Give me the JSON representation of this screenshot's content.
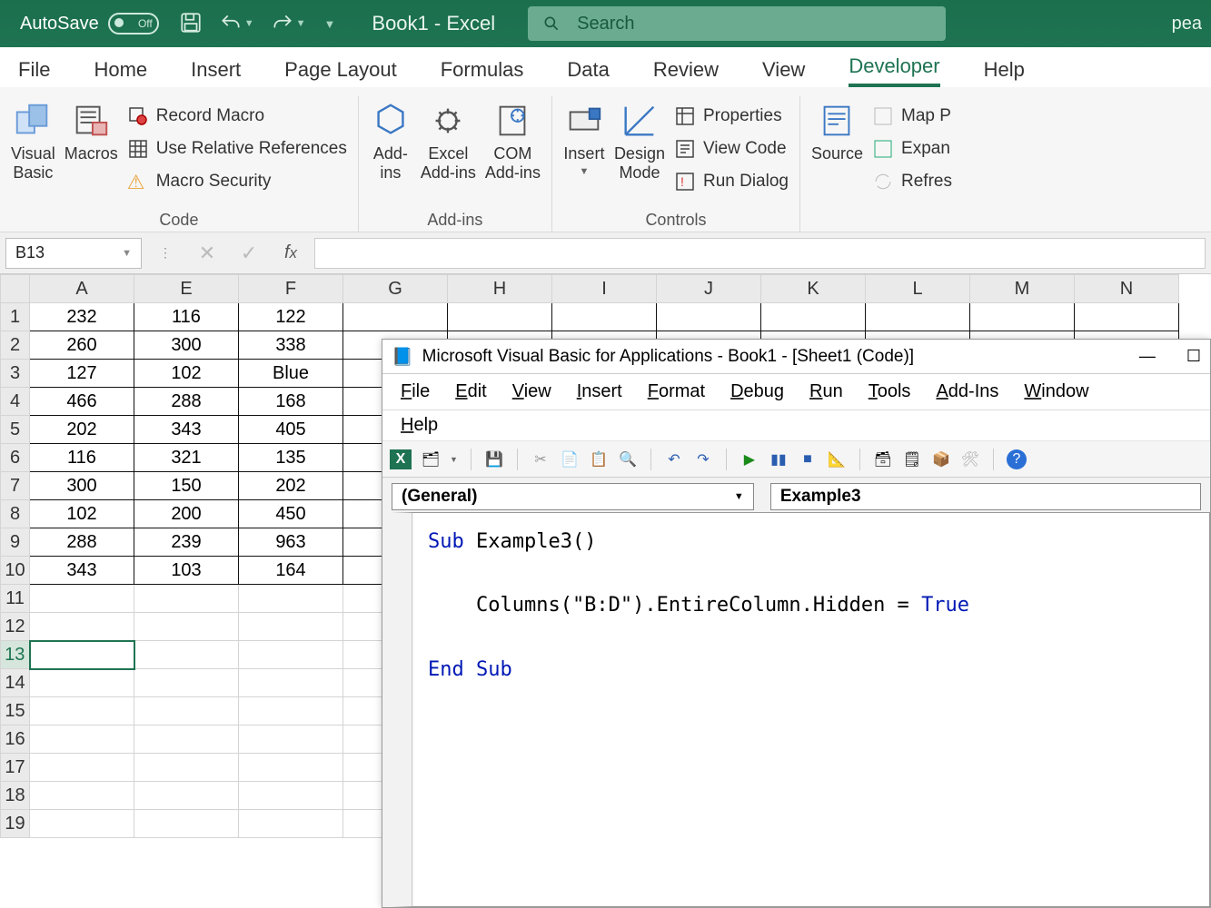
{
  "titlebar": {
    "autosave_label": "AutoSave",
    "autosave_state": "Off",
    "doc_title": "Book1 - Excel",
    "search_placeholder": "Search",
    "user": "pea"
  },
  "tabs": [
    "File",
    "Home",
    "Insert",
    "Page Layout",
    "Formulas",
    "Data",
    "Review",
    "View",
    "Developer",
    "Help"
  ],
  "active_tab": "Developer",
  "ribbon": {
    "code": {
      "visual_basic": "Visual\nBasic",
      "macros": "Macros",
      "record_macro": "Record Macro",
      "use_relative": "Use Relative References",
      "macro_security": "Macro Security",
      "group": "Code"
    },
    "addins": {
      "addins": "Add-\nins",
      "excel_addins": "Excel\nAdd-ins",
      "com_addins": "COM\nAdd-ins",
      "group": "Add-ins"
    },
    "controls": {
      "insert": "Insert",
      "design_mode": "Design\nMode",
      "properties": "Properties",
      "view_code": "View Code",
      "run_dialog": "Run Dialog",
      "group": "Controls"
    },
    "xml": {
      "source": "Source",
      "map": "Map P",
      "expand": "Expan",
      "refresh": "Refres"
    }
  },
  "namebox": "B13",
  "columns": [
    "A",
    "E",
    "F",
    "G",
    "H",
    "I",
    "J",
    "K",
    "L",
    "M",
    "N"
  ],
  "rows_shown": 19,
  "data_rows": [
    {
      "A": "232",
      "E": "116",
      "F": "122"
    },
    {
      "A": "260",
      "E": "300",
      "F": "338"
    },
    {
      "A": "127",
      "E": "102",
      "F": "Blue"
    },
    {
      "A": "466",
      "E": "288",
      "F": "168"
    },
    {
      "A": "202",
      "E": "343",
      "F": "405"
    },
    {
      "A": "116",
      "E": "321",
      "F": "135"
    },
    {
      "A": "300",
      "E": "150",
      "F": "202"
    },
    {
      "A": "102",
      "E": "200",
      "F": "450"
    },
    {
      "A": "288",
      "E": "239",
      "F": "963"
    },
    {
      "A": "343",
      "E": "103",
      "F": "164"
    }
  ],
  "selected_row": 13,
  "vba": {
    "title": "Microsoft Visual Basic for Applications - Book1 - [Sheet1 (Code)]",
    "menu": [
      "File",
      "Edit",
      "View",
      "Insert",
      "Format",
      "Debug",
      "Run",
      "Tools",
      "Add-Ins",
      "Window"
    ],
    "menu2": "Help",
    "dd_left": "(General)",
    "dd_right": "Example3",
    "code_lines": [
      {
        "t": "kw",
        "v": "Sub "
      },
      {
        "t": "",
        "v": "Example3()"
      },
      {
        "t": "br"
      },
      {
        "t": "br"
      },
      {
        "t": "",
        "v": "    Columns(\"B:D\").EntireColumn.Hidden = "
      },
      {
        "t": "kw",
        "v": "True"
      },
      {
        "t": "br"
      },
      {
        "t": "br"
      },
      {
        "t": "kw",
        "v": "End Sub"
      }
    ]
  }
}
